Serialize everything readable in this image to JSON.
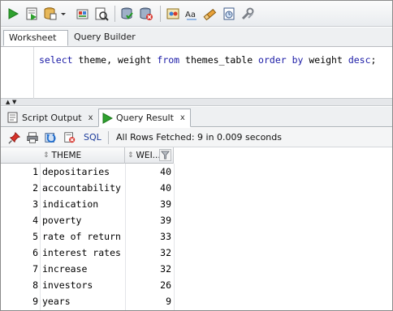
{
  "toolbar": {
    "icons": [
      "run-statement-icon",
      "run-script-icon",
      "database-cylinder-icon",
      "dropdown-arrow-icon",
      "commit-icon",
      "autotrace-icon",
      "explain-plan-icon",
      "rollback-icon",
      "tuning-advisor-icon",
      "case-convert-icon",
      "clear-icon",
      "history-icon",
      "tools-icon"
    ]
  },
  "worksheet_tabs": [
    {
      "label": "Worksheet",
      "active": true
    },
    {
      "label": "Query Builder",
      "active": false
    }
  ],
  "editor": {
    "code_parts": [
      {
        "text": "select",
        "kw": true
      },
      {
        "text": " theme, weight ",
        "kw": false
      },
      {
        "text": "from",
        "kw": true
      },
      {
        "text": " themes_table ",
        "kw": false
      },
      {
        "text": "order by",
        "kw": true
      },
      {
        "text": " weight ",
        "kw": false
      },
      {
        "text": "desc",
        "kw": true
      },
      {
        "text": ";",
        "kw": false
      }
    ]
  },
  "result_tabs": {
    "script_output": "Script Output",
    "query_result": "Query Result",
    "close": "x"
  },
  "result_toolbar": {
    "sql_label": "SQL",
    "status": "All Rows Fetched: 9 in 0.009 seconds"
  },
  "grid": {
    "columns": [
      "THEME",
      "WEI..."
    ],
    "rows": [
      {
        "num": "1",
        "theme": "depositaries",
        "weight": "40"
      },
      {
        "num": "2",
        "theme": "accountability",
        "weight": "40"
      },
      {
        "num": "3",
        "theme": "indication",
        "weight": "39"
      },
      {
        "num": "4",
        "theme": "poverty",
        "weight": "39"
      },
      {
        "num": "5",
        "theme": "rate of return",
        "weight": "33"
      },
      {
        "num": "6",
        "theme": "interest rates",
        "weight": "32"
      },
      {
        "num": "7",
        "theme": "increase",
        "weight": "32"
      },
      {
        "num": "8",
        "theme": "investors",
        "weight": "26"
      },
      {
        "num": "9",
        "theme": "years",
        "weight": "9"
      }
    ]
  },
  "colors": {
    "keyword": "#1a1aa6",
    "run_green": "#2ea12e",
    "accent_blue": "#1a3a9a"
  }
}
